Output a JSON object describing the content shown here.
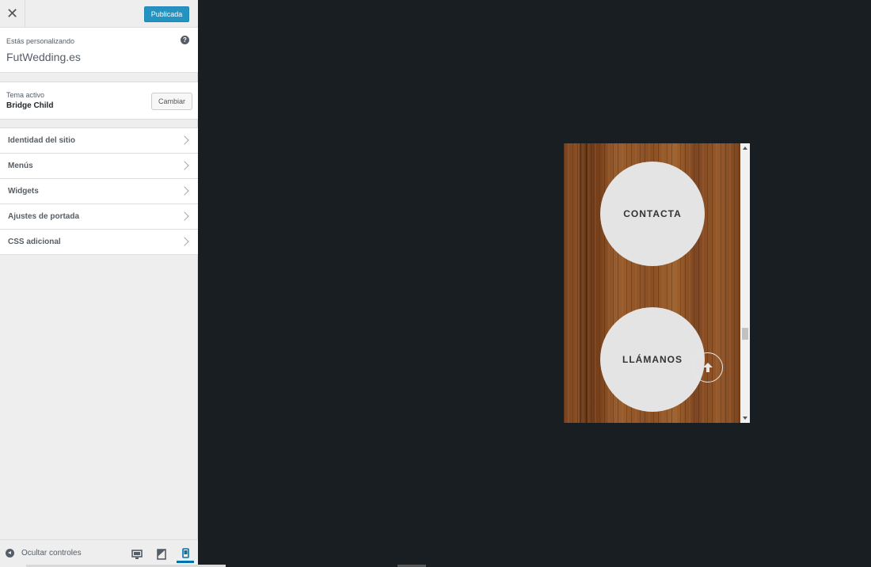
{
  "header": {
    "close_label": "✕",
    "publish_label": "Publicada"
  },
  "info": {
    "customizing_label": "Estás personalizando",
    "site_name": "FutWedding.es",
    "help_label": "?"
  },
  "theme": {
    "active_label": "Tema activo",
    "theme_name": "Bridge Child",
    "change_label": "Cambiar"
  },
  "sections": [
    {
      "label": "Identidad del sitio"
    },
    {
      "label": "Menús"
    },
    {
      "label": "Widgets"
    },
    {
      "label": "Ajustes de portada"
    },
    {
      "label": "CSS adicional"
    }
  ],
  "footer": {
    "hide_label": "Ocultar controles",
    "active_device": "mobile"
  },
  "preview": {
    "button1": "CONTACTA",
    "button2": "LLÁMANOS"
  },
  "colors": {
    "accent": "#0085ba",
    "canvas": "#191e23",
    "panel": "#eeeeee"
  }
}
